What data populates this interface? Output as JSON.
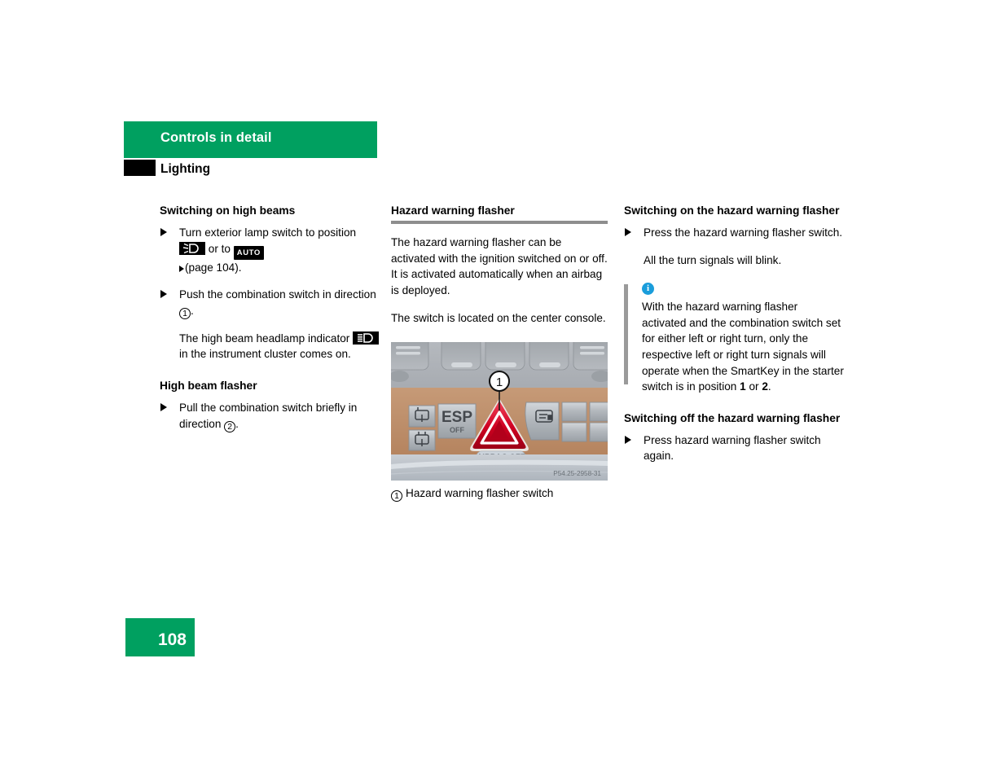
{
  "header": {
    "chapter_title": "Controls in detail",
    "section_title": "Lighting"
  },
  "left_column": {
    "heading_1": "Switching on high beams",
    "step_1_part_a": "Turn exterior lamp switch to position",
    "icon_lowbeam_name": "headlamp-icon",
    "step_1_part_b": "or to",
    "icon_auto_label": "AUTO",
    "step_1_part_c": "page 104).",
    "step_2_part_a": "Push the combination switch in direction",
    "step_2_marker": "1",
    "note_1_part_a": "The high beam headlamp indicator",
    "icon_highbeam_name": "high-beam-indicator-icon",
    "note_1_part_b": "in the instrument cluster comes on.",
    "heading_2": "High beam flasher",
    "step_3_part_a": "Pull the combination switch briefly in direction",
    "step_3_marker": "2"
  },
  "middle_column": {
    "heading": "Hazard warning flasher",
    "paragraph_1": "The hazard warning flasher can be activated with the ignition switched on or off. It is activated automatically when an airbag is deployed.",
    "paragraph_2": "The switch is located on the center console.",
    "figure": {
      "callout_number": "1",
      "esp_label": "ESP",
      "esp_sublabel": "OFF",
      "airbag_label": "AIRBAG OFF",
      "watermark": "P54.25-2958-31",
      "hazard_button_color": "#e2001a"
    },
    "caption_marker": "1",
    "caption_text": "Hazard warning flasher switch"
  },
  "right_column": {
    "heading_1": "Switching on the hazard warning flasher",
    "step_1": "Press the hazard warning flasher switch.",
    "note_1": "All the turn signals will blink.",
    "info_note": {
      "icon_label": "i",
      "text_part_a": "With the hazard warning flasher activated and the combination switch set for either left or right turn, only the respective left or right turn signals will operate when the SmartKey in the starter switch is in position",
      "position_1": "1",
      "text_part_b": "or",
      "position_2": "2",
      "text_part_c": "."
    },
    "heading_2": "Switching off the hazard warning flasher",
    "step_2": "Press hazard warning flasher switch again."
  },
  "footer": {
    "page_number": "108"
  },
  "colors": {
    "brand_green": "#00a060",
    "rule_gray": "#8e8e8e",
    "info_blue": "#1a9ddb"
  }
}
